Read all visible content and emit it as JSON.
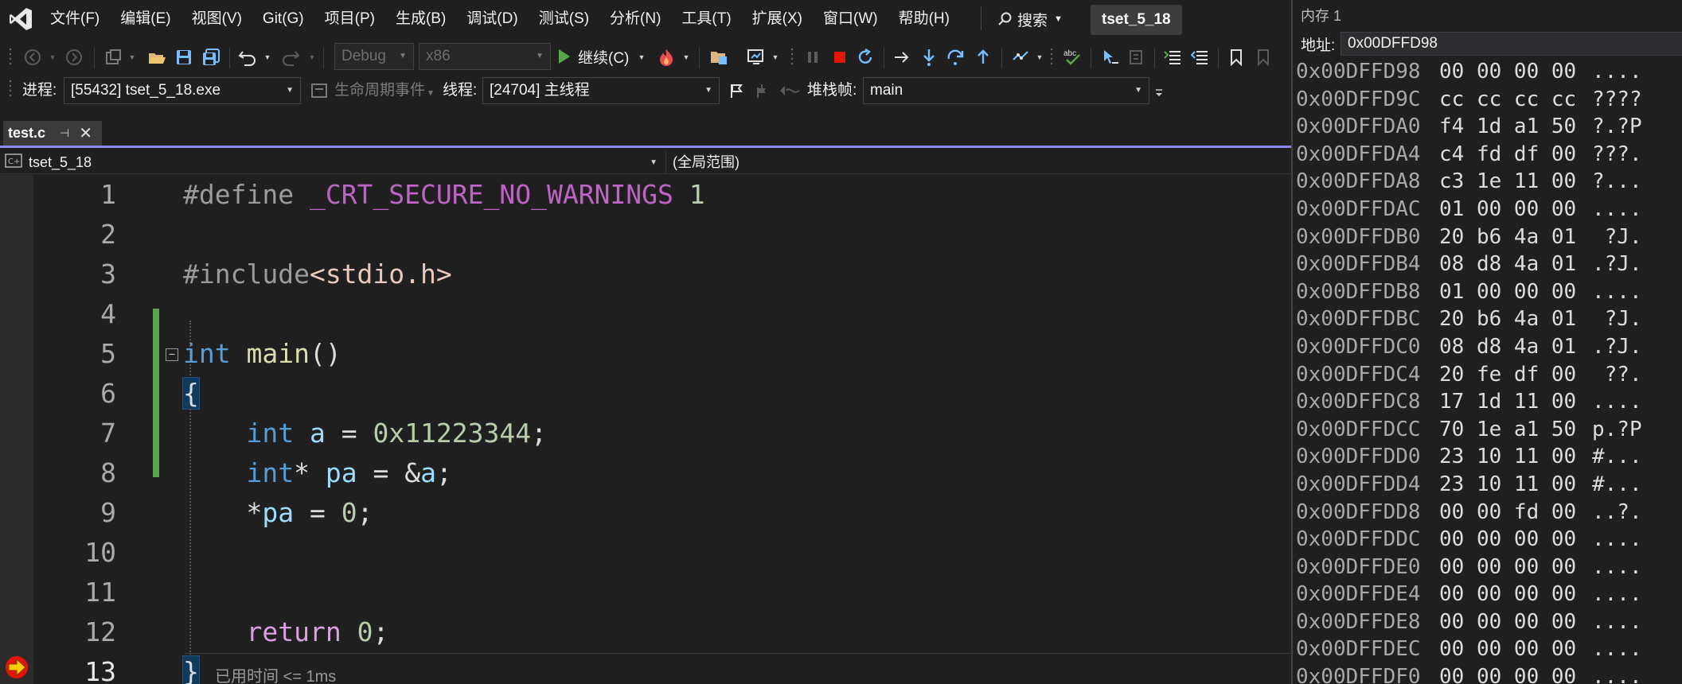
{
  "menubar": {
    "items": [
      "文件(F)",
      "编辑(E)",
      "视图(V)",
      "Git(G)",
      "项目(P)",
      "生成(B)",
      "调试(D)",
      "测试(S)",
      "分析(N)",
      "工具(T)",
      "扩展(X)",
      "窗口(W)",
      "帮助(H)"
    ],
    "search_label": "搜索",
    "solution_name": "tset_5_18"
  },
  "toolbar": {
    "config": "Debug",
    "platform": "x86",
    "continue_label": "继续(C)"
  },
  "debug_location": {
    "process_label": "进程:",
    "process_value": "[55432] tset_5_18.exe",
    "lifecycle_label": "生命周期事件",
    "thread_label": "线程:",
    "thread_value": "[24704] 主线程",
    "stackframe_label": "堆栈帧:",
    "stackframe_value": "main"
  },
  "document": {
    "tab_title": "test.c",
    "nav_project": "tset_5_18",
    "nav_scope": "(全局范围)"
  },
  "editor": {
    "line_numbers": [
      "1",
      "2",
      "3",
      "4",
      "5",
      "6",
      "7",
      "8",
      "9",
      "10",
      "11",
      "12",
      "13"
    ],
    "perf_tip": "已用时间 <= 1ms"
  },
  "memory_window": {
    "title": "内存 1",
    "address_label": "地址:",
    "address_value": "0x00DFFD98",
    "rows": [
      {
        "addr": "0x00DFFD98",
        "bytes": "00 00 00 00",
        "ascii": "...."
      },
      {
        "addr": "0x00DFFD9C",
        "bytes": "cc cc cc cc",
        "ascii": "????"
      },
      {
        "addr": "0x00DFFDA0",
        "bytes": "f4 1d a1 50",
        "ascii": "?.?P"
      },
      {
        "addr": "0x00DFFDA4",
        "bytes": "c4 fd df 00",
        "ascii": "???."
      },
      {
        "addr": "0x00DFFDA8",
        "bytes": "c3 1e 11 00",
        "ascii": "?..."
      },
      {
        "addr": "0x00DFFDAC",
        "bytes": "01 00 00 00",
        "ascii": "...."
      },
      {
        "addr": "0x00DFFDB0",
        "bytes": "20 b6 4a 01",
        "ascii": " ?J."
      },
      {
        "addr": "0x00DFFDB4",
        "bytes": "08 d8 4a 01",
        "ascii": ".?J."
      },
      {
        "addr": "0x00DFFDB8",
        "bytes": "01 00 00 00",
        "ascii": "...."
      },
      {
        "addr": "0x00DFFDBC",
        "bytes": "20 b6 4a 01",
        "ascii": " ?J."
      },
      {
        "addr": "0x00DFFDC0",
        "bytes": "08 d8 4a 01",
        "ascii": ".?J."
      },
      {
        "addr": "0x00DFFDC4",
        "bytes": "20 fe df 00",
        "ascii": " ??."
      },
      {
        "addr": "0x00DFFDC8",
        "bytes": "17 1d 11 00",
        "ascii": "...."
      },
      {
        "addr": "0x00DFFDCC",
        "bytes": "70 1e a1 50",
        "ascii": "p.?P"
      },
      {
        "addr": "0x00DFFDD0",
        "bytes": "23 10 11 00",
        "ascii": "#..."
      },
      {
        "addr": "0x00DFFDD4",
        "bytes": "23 10 11 00",
        "ascii": "#..."
      },
      {
        "addr": "0x00DFFDD8",
        "bytes": "00 00 fd 00",
        "ascii": "..?."
      },
      {
        "addr": "0x00DFFDDC",
        "bytes": "00 00 00 00",
        "ascii": "...."
      },
      {
        "addr": "0x00DFFDE0",
        "bytes": "00 00 00 00",
        "ascii": "...."
      },
      {
        "addr": "0x00DFFDE4",
        "bytes": "00 00 00 00",
        "ascii": "...."
      },
      {
        "addr": "0x00DFFDE8",
        "bytes": "00 00 00 00",
        "ascii": "...."
      },
      {
        "addr": "0x00DFFDEC",
        "bytes": "00 00 00 00",
        "ascii": "...."
      },
      {
        "addr": "0x00DFFDF0",
        "bytes": "00 00 00 00",
        "ascii": "...."
      }
    ]
  },
  "colors": {
    "background": "#1f1f1f",
    "keyword": "#569cd6",
    "macro": "#bd63c5",
    "number": "#b5cea8",
    "string": "#e8c9bb",
    "function": "#dcdcaa",
    "variable": "#9cdcfe",
    "change_bar": "#57a64a",
    "tab_accent": "#8e8af5",
    "stop_red": "#e51400"
  }
}
